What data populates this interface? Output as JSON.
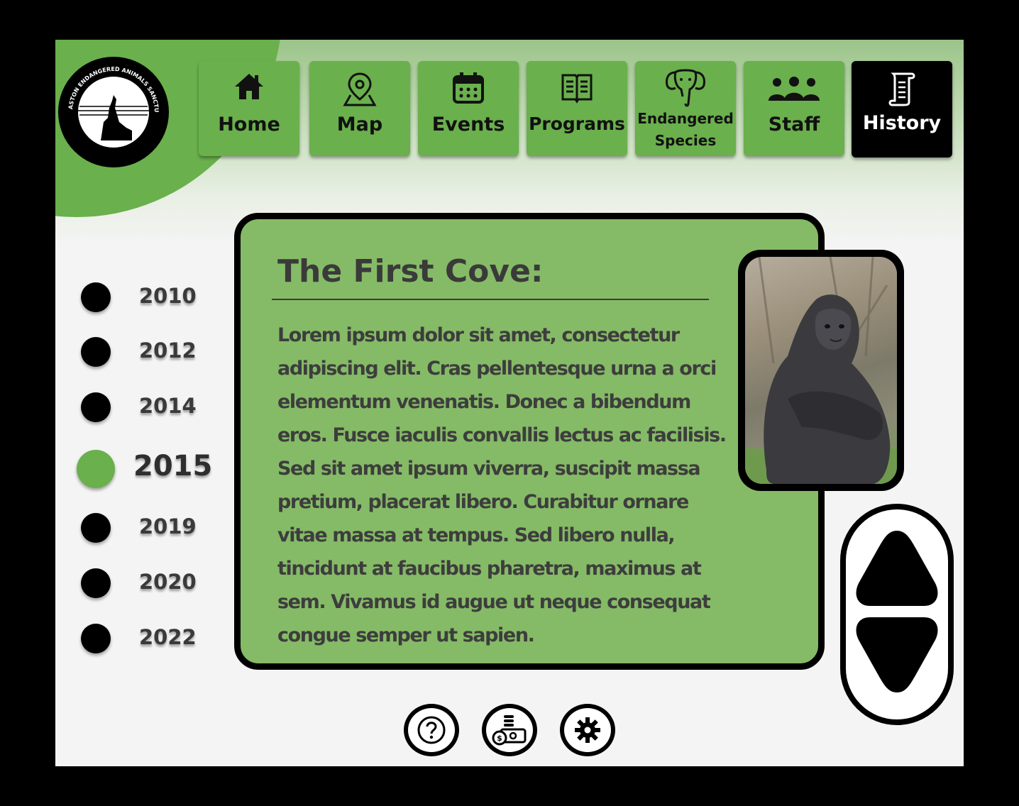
{
  "logo": {
    "text": "ASTON ENDANGERED ANIMALS SANCTUARY",
    "icon": "howling-wolf-logo-icon"
  },
  "nav": {
    "items": [
      {
        "label": "Home",
        "icon": "home-icon"
      },
      {
        "label": "Map",
        "icon": "map-pin-icon"
      },
      {
        "label": "Events",
        "icon": "calendar-icon"
      },
      {
        "label": "Programs",
        "icon": "book-icon"
      },
      {
        "label_line1": "Endangered",
        "label_line2": "Species",
        "icon": "elephant-icon"
      },
      {
        "label": "Staff",
        "icon": "staff-group-icon"
      },
      {
        "label": "History",
        "icon": "scroll-icon",
        "active": true
      }
    ]
  },
  "timeline": {
    "years": [
      "2010",
      "2012",
      "2014",
      "2015",
      "2019",
      "2020",
      "2022"
    ],
    "selected": "2015"
  },
  "card": {
    "title": "The First Cove:",
    "body": "Lorem ipsum dolor sit amet, consectetur adipiscing elit. Cras pellentesque urna a orci elementum venenatis. Donec a bibendum eros. Fusce iaculis convallis lectus ac facilisis. Sed sit amet ipsum viverra, suscipit massa pretium, placerat libero. Curabitur ornare vitae massa at tempus. Sed libero nulla, tincidunt at faucibus pharetra, maximus at sem. Vivamus id augue ut neque consequat congue semper ut sapien.",
    "image": "gorilla-photo"
  },
  "scroll": {
    "up": "scroll-up-arrow-icon",
    "down": "scroll-down-arrow-icon"
  },
  "footer": {
    "icons": [
      "help-icon",
      "donate-money-icon",
      "settings-gear-icon"
    ]
  },
  "colors": {
    "accent": "#6ab04c",
    "card": "#85bb66",
    "active_nav": "#000000"
  }
}
